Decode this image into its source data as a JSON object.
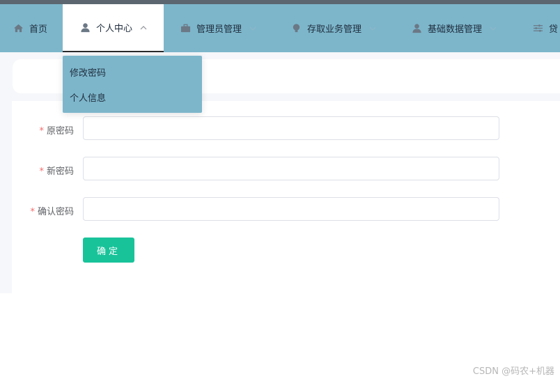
{
  "nav": {
    "items": [
      {
        "label": "首页",
        "icon": "home-icon"
      },
      {
        "label": "个人中心",
        "icon": "user-icon",
        "active": true
      },
      {
        "label": "管理员管理",
        "icon": "briefcase-icon"
      },
      {
        "label": "存取业务管理",
        "icon": "lightbulb-icon"
      },
      {
        "label": "基础数据管理",
        "icon": "user-icon"
      },
      {
        "label": "贷",
        "icon": "sliders-icon"
      }
    ],
    "dropdown": [
      "修改密码",
      "个人信息"
    ]
  },
  "form": {
    "required_mark": "*",
    "old_password_label": "原密码",
    "new_password_label": "新密码",
    "confirm_password_label": "确认密码",
    "old_password_value": "",
    "new_password_value": "",
    "confirm_password_value": "",
    "submit_label": "确定"
  },
  "watermark": "CSDN @码农+机器",
  "colors": {
    "nav_bg": "#7db6cb",
    "button_bg": "#19c39a",
    "required": "#f56c6c"
  }
}
